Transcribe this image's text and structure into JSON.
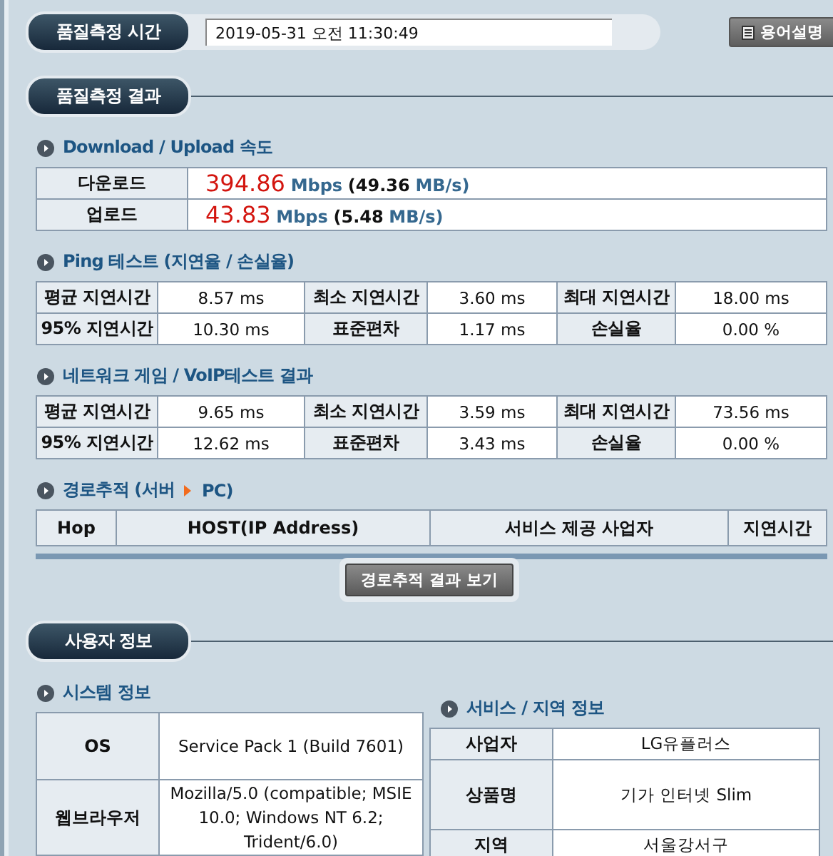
{
  "header": {
    "label": "품질측정 시간",
    "time": "2019-05-31 오전 11:30:49",
    "help_button": "용어설명"
  },
  "result_section": {
    "title": "품질측정 결과"
  },
  "speed": {
    "title": "Download / Upload 속도",
    "rows": [
      {
        "label": "다운로드",
        "value": "394.86",
        "unit": "Mbps",
        "bytes": "(49.36",
        "bytes_unit": "MB/s)"
      },
      {
        "label": "업로드",
        "value": "43.83",
        "unit": "Mbps",
        "bytes": "(5.48",
        "bytes_unit": "MB/s)"
      }
    ]
  },
  "ping": {
    "title": "Ping 테스트 (지연율 / 손실율)",
    "rows": [
      [
        "평균 지연시간",
        "8.57 ms",
        "최소 지연시간",
        "3.60 ms",
        "최대 지연시간",
        "18.00 ms"
      ],
      [
        "95% 지연시간",
        "10.30 ms",
        "표준편차",
        "1.17 ms",
        "손실율",
        "0.00 %"
      ]
    ]
  },
  "game": {
    "title": "네트워크 게임 / VoIP테스트 결과",
    "rows": [
      [
        "평균 지연시간",
        "9.65 ms",
        "최소 지연시간",
        "3.59 ms",
        "최대 지연시간",
        "73.56 ms"
      ],
      [
        "95% 지연시간",
        "12.62 ms",
        "표준편차",
        "3.43 ms",
        "손실율",
        "0.00 %"
      ]
    ]
  },
  "route": {
    "title_start": "경로추적 (서버",
    "title_end": "PC)",
    "columns": [
      "Hop",
      "HOST(IP Address)",
      "서비스 제공 사업자",
      "지연시간"
    ],
    "button": "경로추적 결과 보기"
  },
  "user_section": {
    "title": "사용자 정보"
  },
  "system": {
    "title": "시스템 정보",
    "rows": [
      {
        "label": "OS",
        "value": "Service Pack 1 (Build 7601)"
      },
      {
        "label": "웹브라우저",
        "value": "Mozilla/5.0 (compatible; MSIE 10.0; Windows NT 6.2; Trident/6.0)"
      }
    ]
  },
  "service": {
    "title": "서비스 / 지역 정보",
    "rows": [
      {
        "label": "사업자",
        "value": "LG유플러스"
      },
      {
        "label": "상품명",
        "value": "기가 인터넷 Slim"
      },
      {
        "label": "지역",
        "value": "서울강서구"
      }
    ]
  }
}
